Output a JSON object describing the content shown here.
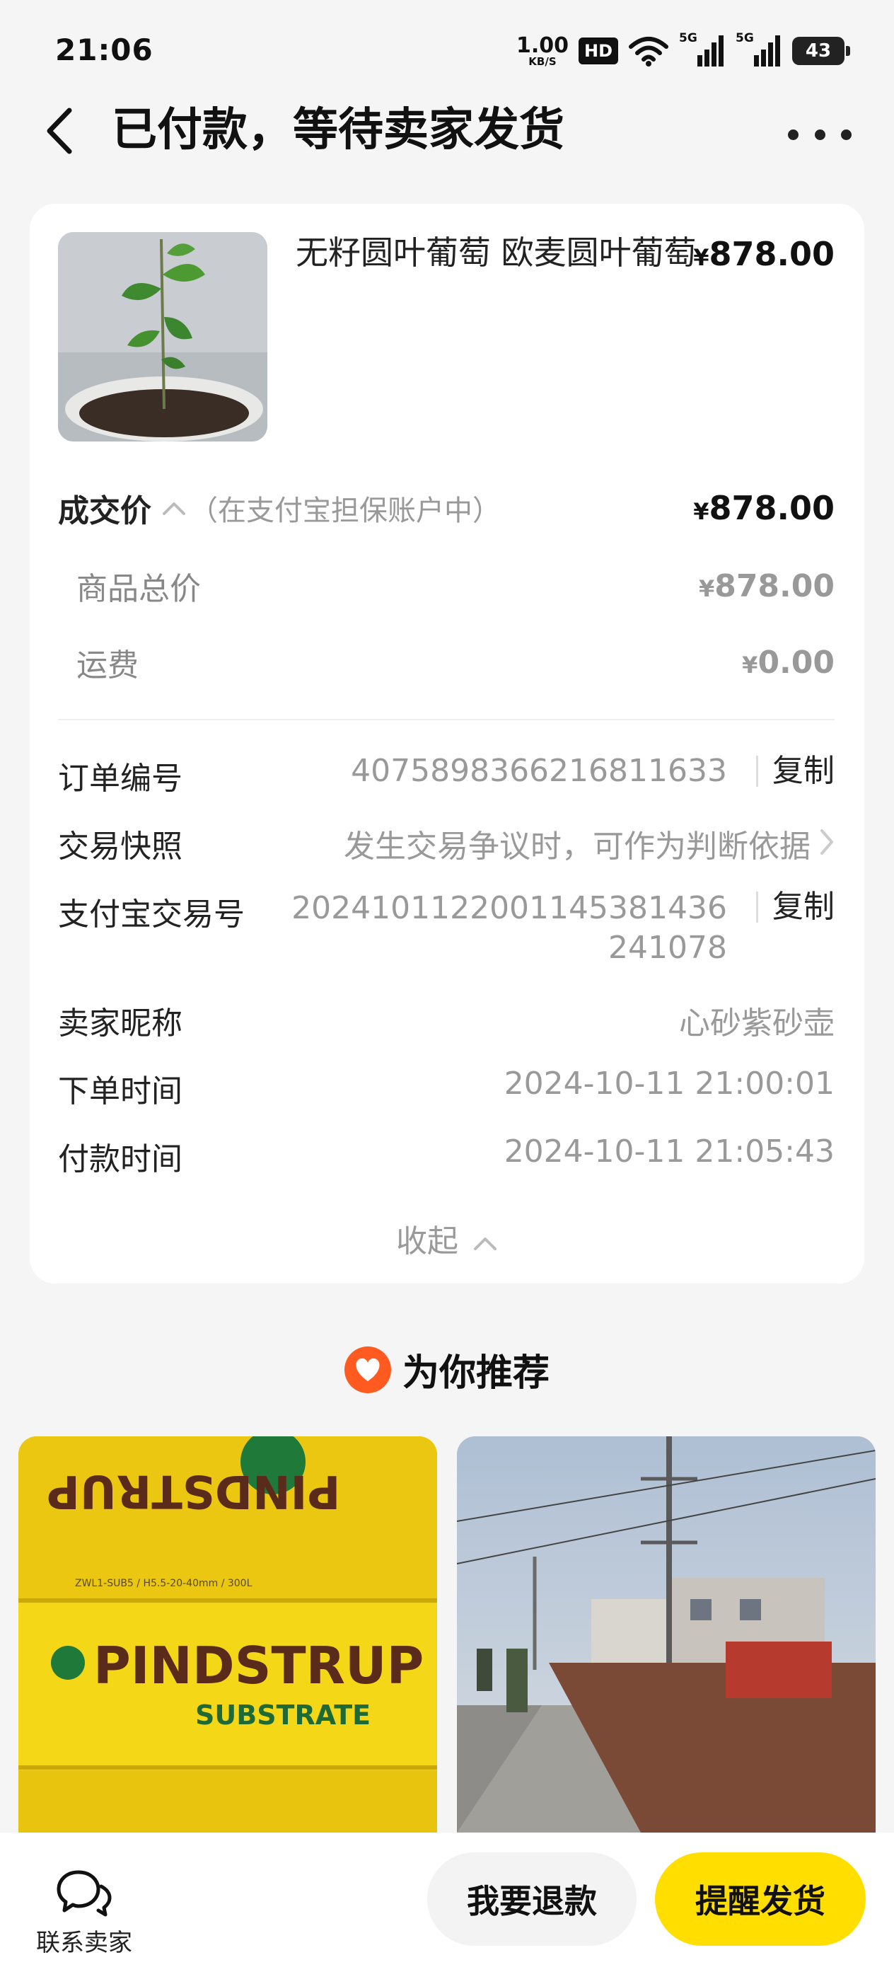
{
  "status_bar": {
    "time": "21:06",
    "net_speed_value": "1.00",
    "net_speed_unit": "KB/S",
    "hd_label": "HD",
    "signal_1_label": "5G",
    "signal_2_label": "5G",
    "battery": "43"
  },
  "header": {
    "title": "已付款，等待卖家发货"
  },
  "product": {
    "name": "无籽圆叶葡萄 欧麦圆叶葡萄",
    "price_symbol": "¥",
    "price": "878.00"
  },
  "price_summary": {
    "deal_label": "成交价",
    "deal_note": "（在支付宝担保账户中）",
    "deal_symbol": "¥",
    "deal_value": "878.00",
    "goods_label": "商品总价",
    "goods_symbol": "¥",
    "goods_value": "878.00",
    "shipping_label": "运费",
    "shipping_symbol": "¥",
    "shipping_value": "0.00"
  },
  "order_info": {
    "order_no_label": "订单编号",
    "order_no": "4075898366216811633",
    "copy_label": "复制",
    "snapshot_label": "交易快照",
    "snapshot_value": "发生交易争议时，可作为判断依据",
    "alipay_no_label": "支付宝交易号",
    "alipay_no_line1": "2024101122001145381436",
    "alipay_no_line2": "241078",
    "seller_label": "卖家昵称",
    "seller_name": "心砂紫砂壶",
    "order_time_label": "下单时间",
    "order_time": "2024-10-11 21:00:01",
    "pay_time_label": "付款时间",
    "pay_time": "2024-10-11 21:05:43",
    "collapse_label": "收起"
  },
  "recommend": {
    "title": "为你推荐",
    "item1_brand": "PINDSTRUP",
    "item1_sub": "SUBSTRATE",
    "item1_spec": "ZWL1-SUB5 / H5.5-20-40mm / 300L"
  },
  "bottom_bar": {
    "contact_label": "联系卖家",
    "refund_label": "我要退款",
    "remind_label": "提醒发货"
  },
  "colors": {
    "accent_yellow": "#ffde00",
    "recommend_badge": "#ff5a1f",
    "muted_text": "#999999"
  }
}
